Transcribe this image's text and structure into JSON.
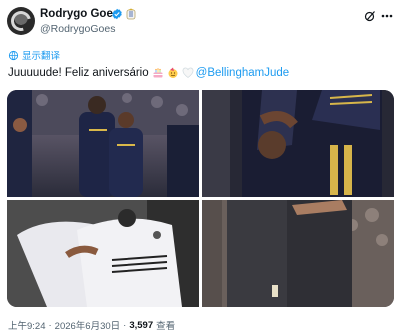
{
  "author": {
    "name": "Rodrygo Goes",
    "handle": "@RodrygoGoes",
    "verified": true,
    "avatar_icon": "avatar-photo"
  },
  "header_icons": [
    "grok-icon",
    "more-icon"
  ],
  "translate_label": "显示翻译",
  "post": {
    "text": "Juuuuude! Feliz aniversário",
    "emojis": [
      "birthday-cake-emoji",
      "party-face-emoji",
      "white-heart-emoji"
    ],
    "mention": "@BellinghamJude"
  },
  "media": {
    "photos": [
      {
        "alt": "photo-celebration-two-players"
      },
      {
        "alt": "photo-embrace-closeup"
      },
      {
        "alt": "photo-hug-white-kit"
      },
      {
        "alt": "photo-embrace-dark-kit"
      }
    ]
  },
  "meta": {
    "time": "上午9:24",
    "separator": "·",
    "date": "2026年6月30日",
    "views_count": "3,597",
    "views_label": "查看"
  },
  "colors": {
    "link": "#1d9bf0",
    "text": "#0f1419",
    "muted": "#536471"
  }
}
